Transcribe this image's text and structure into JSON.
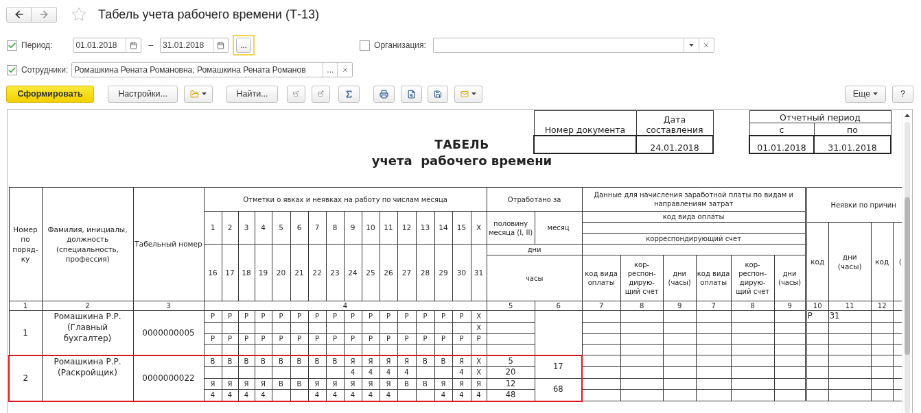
{
  "title": "Табель учета рабочего времени (Т-13)",
  "favorite": false,
  "filters": {
    "period": {
      "label": "Период:",
      "checked": true,
      "from": "01.01.2018",
      "separator": "–",
      "to": "31.01.2018",
      "picker": {
        "label": "...",
        "focused": true
      }
    },
    "organization": {
      "label": "Организация:",
      "checked": false
    },
    "employees": {
      "label": "Сотрудники:",
      "checked": true,
      "value": "Ромашкина Рената Романовна; Ромашкина Рената Романов",
      "picker": "..."
    }
  },
  "toolbar": {
    "generate": "Сформировать",
    "settings": "Настройки...",
    "find": "Найти...",
    "more": "Еще",
    "help": "?"
  },
  "report": {
    "title": "ТАБЕЛЬ",
    "subtitle": "учета  рабочего времени",
    "document": {
      "number_label": "Номер документа",
      "date_label": "Дата составления",
      "date": "24.01.2018"
    },
    "period": {
      "label": "Отчетный период",
      "from_label": "с",
      "to_label": "по",
      "from": "01.01.2018",
      "to": "31.01.2018"
    },
    "table": {
      "headers": {
        "row_number": "Номер по поряд-ку",
        "employee": "Фамилия, инициалы, должность (специальность, профессия)",
        "personnel_number": "Табельный номер",
        "marks": "Отметки о явках и неявках на работу по числам месяца",
        "days_first": [
          "1",
          "2",
          "3",
          "4",
          "5",
          "6",
          "7",
          "8",
          "9",
          "10",
          "11",
          "12",
          "13",
          "14",
          "15",
          "X"
        ],
        "days_second": [
          "16",
          "17",
          "18",
          "19",
          "20",
          "21",
          "22",
          "23",
          "24",
          "25",
          "26",
          "27",
          "28",
          "29",
          "30",
          "31"
        ],
        "worked": "Отработано за",
        "half_month": "половину месяца (I, II)",
        "month": "месяц",
        "days": "дни",
        "hours": "часы",
        "payroll": "Данные для начисления заработной платы по видам и направлениям затрат",
        "pay_code": "код вида оплаты",
        "account": "корреспондирующий счет",
        "payroll_columns": [
          "код вида оплаты",
          "кор-респон-дирую-щий счет",
          "дни (часы)",
          "код вида оплаты",
          "кор-респон-дирую-щий счет",
          "дни (часы)"
        ],
        "absences": "Неявки по причин",
        "absence_columns": [
          "код",
          "дни (часы)",
          "код",
          "("
        ]
      },
      "column_numbers": [
        "1",
        "2",
        "3",
        "4",
        "5",
        "6",
        "7",
        "8",
        "9",
        "7",
        "8",
        "9",
        "10",
        "11",
        "12"
      ],
      "employees": [
        {
          "number": "1",
          "name": "Ромашкина Р.Р. (Главный бухгалтер)",
          "personnel_number": "0000000005",
          "highlighted": false,
          "marks": [
            [
              {
                "kind": "mark",
                "text": "Р"
              },
              {
                "kind": "mark",
                "text": "Р"
              },
              {
                "kind": "mark",
                "text": "Р"
              },
              {
                "kind": "mark",
                "text": "Р"
              },
              {
                "kind": "mark",
                "text": "Р"
              },
              {
                "kind": "mark",
                "text": "Р"
              },
              {
                "kind": "mark",
                "text": "Р"
              },
              {
                "kind": "mark",
                "text": "Р"
              },
              {
                "kind": "mark",
                "text": "Р"
              },
              {
                "kind": "mark",
                "text": "Р"
              },
              {
                "kind": "mark",
                "text": "Р"
              },
              {
                "kind": "mark",
                "text": "Р"
              },
              {
                "kind": "mark",
                "text": "Р"
              },
              {
                "kind": "mark",
                "text": "Р"
              },
              {
                "kind": "mark",
                "text": "Р"
              },
              {
                "kind": "mark",
                "text": "X"
              }
            ],
            [
              {
                "kind": "blank"
              },
              {
                "kind": "blank"
              },
              {
                "kind": "blank"
              },
              {
                "kind": "blank"
              },
              {
                "kind": "blank"
              },
              {
                "kind": "blank"
              },
              {
                "kind": "blank"
              },
              {
                "kind": "blank"
              },
              {
                "kind": "blank"
              },
              {
                "kind": "blank"
              },
              {
                "kind": "blank"
              },
              {
                "kind": "blank"
              },
              {
                "kind": "blank"
              },
              {
                "kind": "blank"
              },
              {
                "kind": "blank"
              },
              {
                "kind": "mark",
                "text": "X"
              }
            ],
            [
              {
                "kind": "mark",
                "text": "Р"
              },
              {
                "kind": "mark",
                "text": "Р"
              },
              {
                "kind": "mark",
                "text": "Р"
              },
              {
                "kind": "mark",
                "text": "Р"
              },
              {
                "kind": "mark",
                "text": "Р"
              },
              {
                "kind": "mark",
                "text": "Р"
              },
              {
                "kind": "mark",
                "text": "Р"
              },
              {
                "kind": "mark",
                "text": "Р"
              },
              {
                "kind": "mark",
                "text": "Р"
              },
              {
                "kind": "mark",
                "text": "Р"
              },
              {
                "kind": "mark",
                "text": "Р"
              },
              {
                "kind": "mark",
                "text": "Р"
              },
              {
                "kind": "mark",
                "text": "Р"
              },
              {
                "kind": "mark",
                "text": "Р"
              },
              {
                "kind": "mark",
                "text": "Р"
              },
              {
                "kind": "mark",
                "text": "Р"
              }
            ],
            [
              {
                "kind": "blank"
              },
              {
                "kind": "blank"
              },
              {
                "kind": "blank"
              },
              {
                "kind": "blank"
              },
              {
                "kind": "blank"
              },
              {
                "kind": "blank"
              },
              {
                "kind": "blank"
              },
              {
                "kind": "blank"
              },
              {
                "kind": "blank"
              },
              {
                "kind": "blank"
              },
              {
                "kind": "blank"
              },
              {
                "kind": "blank"
              },
              {
                "kind": "blank"
              },
              {
                "kind": "blank"
              },
              {
                "kind": "blank"
              },
              {
                "kind": "blank"
              }
            ]
          ],
          "absences": [
            {
              "code": "Р",
              "days": "31"
            }
          ]
        },
        {
          "number": "2",
          "name": "Ромашкина Р.Р. (Раскройщик)",
          "personnel_number": "0000000022",
          "highlighted": true,
          "marks": [
            [
              {
                "kind": "mark",
                "text": "В"
              },
              {
                "kind": "mark",
                "text": "В"
              },
              {
                "kind": "mark",
                "text": "В"
              },
              {
                "kind": "mark",
                "text": "В"
              },
              {
                "kind": "mark",
                "text": "В"
              },
              {
                "kind": "mark",
                "text": "В"
              },
              {
                "kind": "mark",
                "text": "В"
              },
              {
                "kind": "mark",
                "text": "В"
              },
              {
                "kind": "mark",
                "text": "Я"
              },
              {
                "kind": "mark",
                "text": "Я"
              },
              {
                "kind": "mark",
                "text": "Я"
              },
              {
                "kind": "mark",
                "text": "Я"
              },
              {
                "kind": "mark",
                "text": "В"
              },
              {
                "kind": "mark",
                "text": "В"
              },
              {
                "kind": "mark",
                "text": "Я"
              },
              {
                "kind": "mark",
                "text": "X"
              }
            ],
            [
              {
                "kind": "blank"
              },
              {
                "kind": "blank"
              },
              {
                "kind": "blank"
              },
              {
                "kind": "blank"
              },
              {
                "kind": "blank"
              },
              {
                "kind": "blank"
              },
              {
                "kind": "blank"
              },
              {
                "kind": "blank"
              },
              {
                "kind": "mark",
                "text": "4"
              },
              {
                "kind": "mark",
                "text": "4"
              },
              {
                "kind": "mark",
                "text": "4"
              },
              {
                "kind": "mark",
                "text": "4"
              },
              {
                "kind": "blank"
              },
              {
                "kind": "blank"
              },
              {
                "kind": "mark",
                "text": "4"
              },
              {
                "kind": "mark",
                "text": "X"
              }
            ],
            [
              {
                "kind": "mark",
                "text": "Я"
              },
              {
                "kind": "mark",
                "text": "Я"
              },
              {
                "kind": "mark",
                "text": "Я"
              },
              {
                "kind": "mark",
                "text": "Я"
              },
              {
                "kind": "mark",
                "text": "В"
              },
              {
                "kind": "mark",
                "text": "В"
              },
              {
                "kind": "mark",
                "text": "Я"
              },
              {
                "kind": "mark",
                "text": "Я"
              },
              {
                "kind": "mark",
                "text": "Я"
              },
              {
                "kind": "mark",
                "text": "Я"
              },
              {
                "kind": "mark",
                "text": "Я"
              },
              {
                "kind": "mark",
                "text": "В"
              },
              {
                "kind": "mark",
                "text": "В"
              },
              {
                "kind": "mark",
                "text": "Я"
              },
              {
                "kind": "mark",
                "text": "Я"
              },
              {
                "kind": "mark",
                "text": "Я"
              }
            ],
            [
              {
                "kind": "mark",
                "text": "4"
              },
              {
                "kind": "mark",
                "text": "4"
              },
              {
                "kind": "mark",
                "text": "4"
              },
              {
                "kind": "mark",
                "text": "4"
              },
              {
                "kind": "blank"
              },
              {
                "kind": "blank"
              },
              {
                "kind": "mark",
                "text": "4"
              },
              {
                "kind": "mark",
                "text": "4"
              },
              {
                "kind": "mark",
                "text": "4"
              },
              {
                "kind": "mark",
                "text": "4"
              },
              {
                "kind": "mark",
                "text": "4"
              },
              {
                "kind": "blank"
              },
              {
                "kind": "blank"
              },
              {
                "kind": "mark",
                "text": "4"
              },
              {
                "kind": "mark",
                "text": "4"
              },
              {
                "kind": "mark",
                "text": "4"
              }
            ]
          ],
          "half_month": [
            "5",
            "20",
            "12",
            "48"
          ],
          "month": [
            "17",
            "68"
          ]
        }
      ]
    }
  }
}
